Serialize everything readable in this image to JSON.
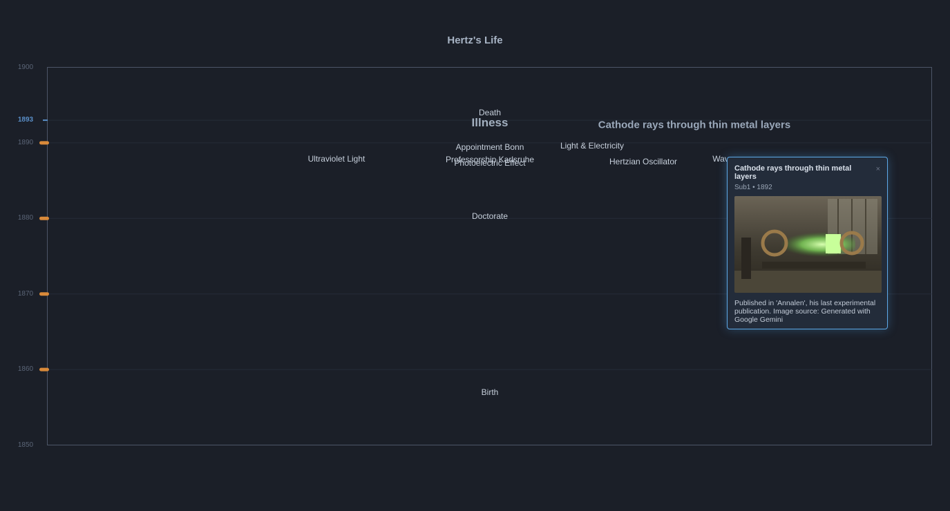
{
  "chart_data": {
    "type": "scatter",
    "title": "Hertz's Life",
    "ylim": [
      1850,
      1900
    ],
    "y_ticks": [
      {
        "value": 1900,
        "label": "1900",
        "marker": false,
        "highlight": false
      },
      {
        "value": 1893,
        "label": "1893",
        "marker": false,
        "highlight": true
      },
      {
        "value": 1890,
        "label": "1890",
        "marker": true,
        "highlight": false
      },
      {
        "value": 1880,
        "label": "1880",
        "marker": true,
        "highlight": false
      },
      {
        "value": 1870,
        "label": "1870",
        "marker": true,
        "highlight": false
      },
      {
        "value": 1860,
        "label": "1860",
        "marker": true,
        "highlight": false
      },
      {
        "value": 1850,
        "label": "1850",
        "marker": false,
        "highlight": false
      }
    ],
    "events": [
      {
        "name": "Birth",
        "year": 1857
      },
      {
        "name": "Doctorate",
        "year": 1880.3
      },
      {
        "name": "Photoelectric Effect",
        "year": 1887.3
      },
      {
        "name": "Professorship Karlsruhe",
        "year": 1887.8
      },
      {
        "name": "Ultraviolet Light",
        "year": 1887.9
      },
      {
        "name": "Hertzian Oscillator",
        "year": 1887.5
      },
      {
        "name": "Wav",
        "year": 1887.9
      },
      {
        "name": "Appointment Bonn",
        "year": 1889.4
      },
      {
        "name": "Light & Electricity",
        "year": 1889.6
      },
      {
        "name": "Illness",
        "year": 1892.6
      },
      {
        "name": "Cathode rays through thin metal layers",
        "year": 1892.4
      },
      {
        "name": "Death",
        "year": 1894
      }
    ]
  },
  "tooltip": {
    "title": "Cathode rays through thin metal layers",
    "subtitle": "Sub1 • 1892",
    "description": "Published in 'Annalen', his last experimental publication. Image source: Generated with Google Gemini",
    "close": "×"
  },
  "colors": {
    "background": "#1b1f28",
    "axis": "#4d5668",
    "marker": "#d98a3a",
    "highlight": "#5a8fc8",
    "tooltip_border": "#5da9e8"
  }
}
